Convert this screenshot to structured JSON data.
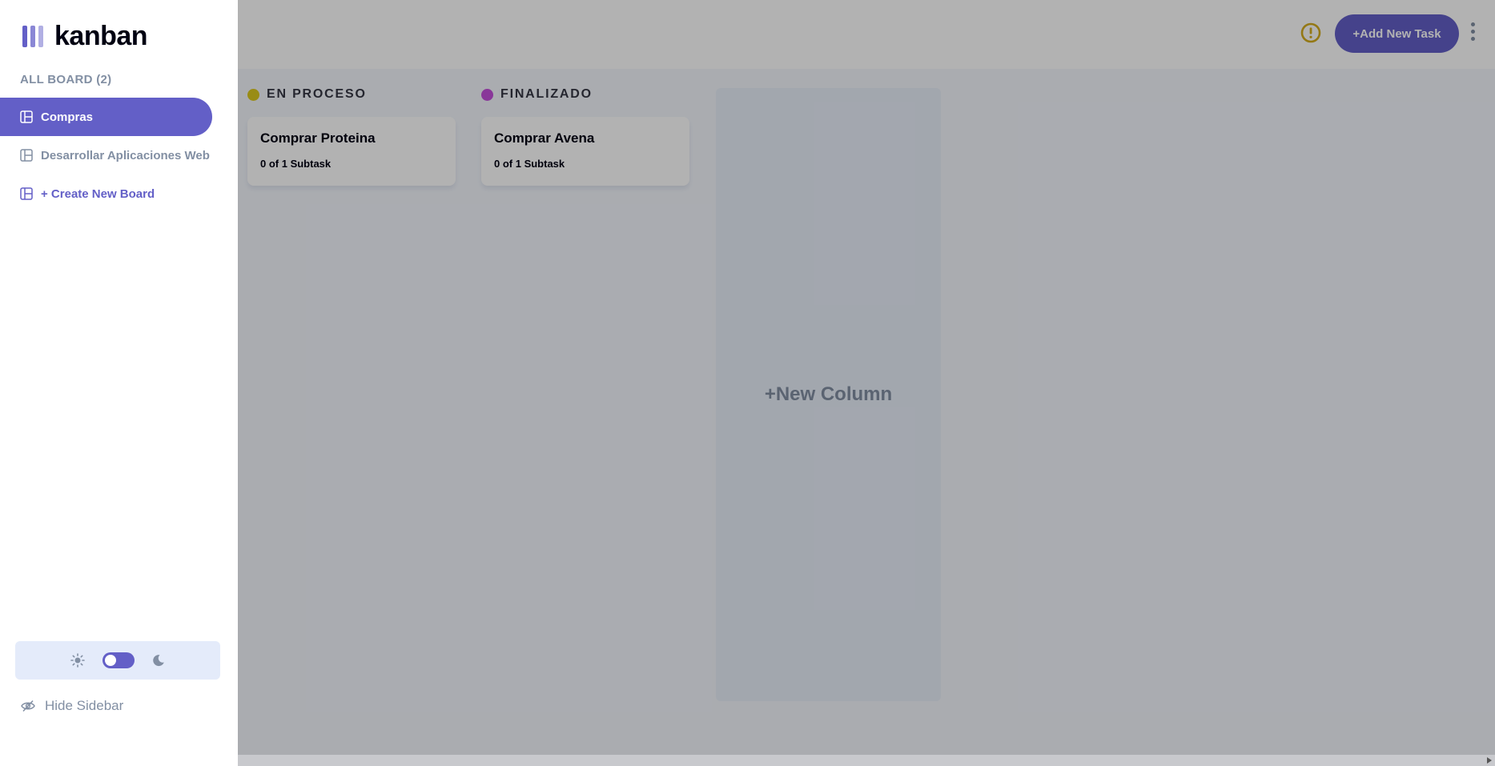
{
  "app": {
    "logo_text": "kanban"
  },
  "sidebar": {
    "boards_title": "ALL BOARD (2)",
    "items": [
      {
        "label": "Compras",
        "active": true
      },
      {
        "label": "Desarrollar Aplicaciones Web",
        "active": false
      }
    ],
    "create_label": "+ Create New Board",
    "hide_label": "Hide Sidebar"
  },
  "header": {
    "add_task_label": "+Add New Task"
  },
  "columns": [
    {
      "title": "EN PROCESO",
      "color": "#dcc91f",
      "tasks": [
        {
          "title": "Comprar Proteina",
          "subtasks": "0 of 1 Subtask"
        }
      ]
    },
    {
      "title": "FINALIZADO",
      "color": "#c44fdb",
      "tasks": [
        {
          "title": "Comprar Avena",
          "subtasks": "0 of 1 Subtask"
        }
      ]
    }
  ],
  "new_column_label": "+New Column",
  "colors": {
    "accent": "#635fc7",
    "warning": "#d4ad1f"
  },
  "icons": [
    "board-icon",
    "sun-icon",
    "moon-icon",
    "eye-slash-icon",
    "warning-icon",
    "kebab-icon"
  ]
}
